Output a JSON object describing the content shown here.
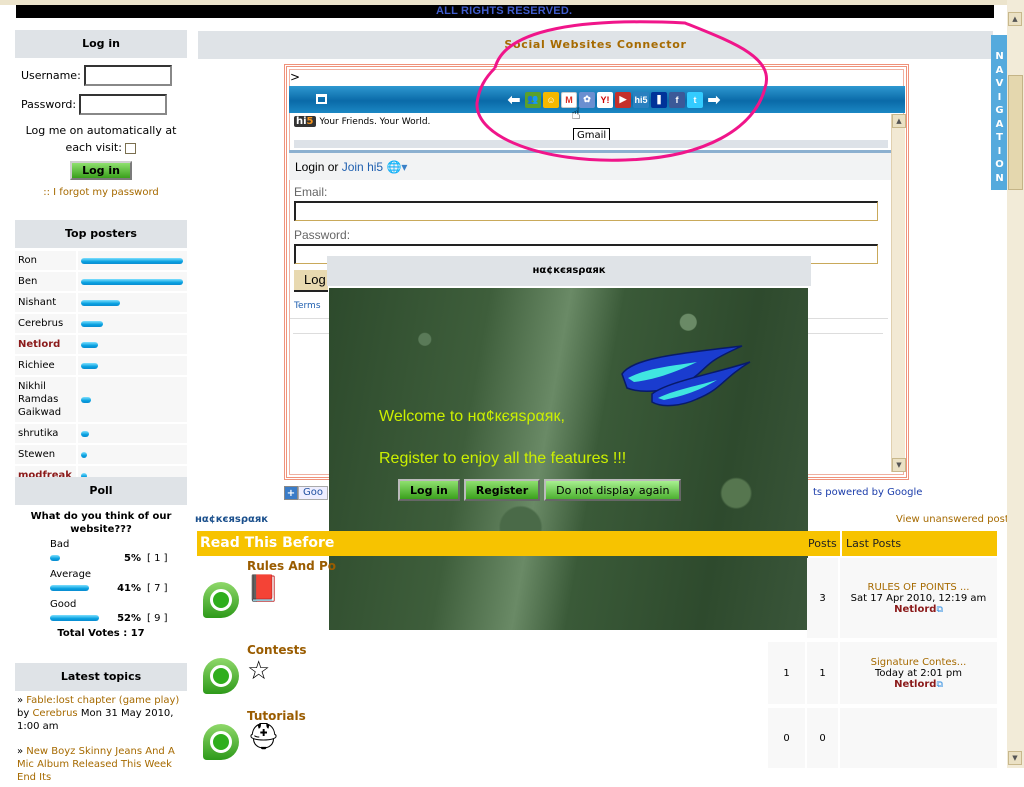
{
  "header": {
    "rights_text": "ALL RIGHTS RESERVED."
  },
  "login_box": {
    "title": "Log in",
    "username_label": "Username:",
    "username_value": "",
    "password_label": "Password:",
    "password_value": "",
    "auto_login_label_1": "Log me on automatically at",
    "auto_login_label_2": "each visit:",
    "auto_login_checked": false,
    "login_button": "Log in",
    "forgot_link": ":: I forgot my password"
  },
  "top_posters": {
    "title": "Top posters",
    "items": [
      {
        "name": "Ron",
        "moderator": false,
        "relative_posts": 1.0
      },
      {
        "name": "Ben",
        "moderator": false,
        "relative_posts": 1.0
      },
      {
        "name": "Nishant",
        "moderator": false,
        "relative_posts": 0.38
      },
      {
        "name": "Cerebrus",
        "moderator": false,
        "relative_posts": 0.22
      },
      {
        "name": "Netlord",
        "moderator": true,
        "relative_posts": 0.17
      },
      {
        "name": "Richiee",
        "moderator": false,
        "relative_posts": 0.17
      },
      {
        "name": "Nikhil Ramdas Gaikwad",
        "moderator": false,
        "relative_posts": 0.1
      },
      {
        "name": "shrutika",
        "moderator": false,
        "relative_posts": 0.08
      },
      {
        "name": "Stewen",
        "moderator": false,
        "relative_posts": 0.06
      },
      {
        "name": "modfreak",
        "moderator": true,
        "relative_posts": 0.06
      }
    ]
  },
  "poll": {
    "title": "Poll",
    "question": "What do you think of our website???",
    "options": [
      {
        "label": "Bad",
        "percent": "5%",
        "votes": "[ 1 ]",
        "fraction": 0.05
      },
      {
        "label": "Average",
        "percent": "41%",
        "votes": "[ 7 ]",
        "fraction": 0.41
      },
      {
        "label": "Good",
        "percent": "52%",
        "votes": "[ 9 ]",
        "fraction": 0.52
      }
    ],
    "total": "Total Votes : 17"
  },
  "latest_topics": {
    "title": "Latest topics",
    "items": [
      {
        "prefix": "» ",
        "title": "Fable:lost chapter (game play)",
        "by": "by ",
        "author": "Cerebrus",
        "date": " Mon 31 May 2010, 1:00 am"
      },
      {
        "prefix": "» ",
        "title": "New Boyz Skinny Jeans And A Mic Album Released This Week End Its",
        "by": "",
        "author": "",
        "date": ""
      }
    ]
  },
  "connector": {
    "title": "Social Websites Connector",
    "prompt": ">",
    "services": [
      {
        "name": "Windows Live Messenger",
        "glyph": "👥",
        "color": "#5aa02c"
      },
      {
        "name": "Yahoo Messenger",
        "glyph": "☺",
        "color": "#f5b800"
      },
      {
        "name": "Gmail",
        "glyph": "M",
        "color": "#d93025"
      },
      {
        "name": "MSN",
        "glyph": "✿",
        "color": "#6a8fd0"
      },
      {
        "name": "Yahoo",
        "glyph": "Y!",
        "color": "#7b0099"
      },
      {
        "name": "YouTube",
        "glyph": "▶",
        "color": "#c4302b"
      },
      {
        "name": "hi5",
        "glyph": "hi5",
        "color": "#2a80c0"
      },
      {
        "name": "MySpace",
        "glyph": "❚",
        "color": "#003399"
      },
      {
        "name": "Facebook",
        "glyph": "f",
        "color": "#3b5998"
      },
      {
        "name": "Twitter",
        "glyph": "t",
        "color": "#33ccff"
      }
    ],
    "tooltip": "Gmail",
    "hi5": {
      "logo_a": "hi",
      "logo_b": "5",
      "tagline": "Your Friends. Your World.",
      "login_text": "Login",
      "or_text": " or ",
      "join_link": "Join hi5",
      "email_label": "Email:",
      "email_value": "",
      "password_label": "Password:",
      "password_value": "",
      "login_button": "Log",
      "terms_link": "Terms"
    },
    "gplus_label": "Goo",
    "powered_text": "ts powered by Google"
  },
  "popup": {
    "title": "нα¢кєяѕραяк",
    "welcome": "Welcome to нα¢кєяѕραяк,",
    "message": "Register to enjoy all the features !!!",
    "login_button": "Log in",
    "register_button": "Register",
    "dismiss_button": "Do not display again"
  },
  "forum": {
    "site_name": "нα¢кєяѕραяк",
    "unanswered_link": "View unanswered posts",
    "category_title": "Read This Before",
    "col_posts": "Posts",
    "col_last": "Last Posts",
    "rows": [
      {
        "title": "Rules And Po",
        "icon": "rules-book-icon",
        "glyph": "📕",
        "topics": "",
        "posts": "3",
        "last_title": "RULES OF POINTS ...",
        "last_date": "Sat 17 Apr 2010, 12:19 am",
        "last_user": "Netlord"
      },
      {
        "title": "Contests",
        "icon": "star-icon",
        "glyph": "☆",
        "topics": "1",
        "posts": "1",
        "last_title": "Signature Contes...",
        "last_date": "Today at 2:01 pm",
        "last_user": "Netlord"
      },
      {
        "title": "Tutorials",
        "icon": "lifebuoy-icon",
        "glyph": "⛑",
        "topics": "0",
        "posts": "0",
        "last_title": "",
        "last_date": "",
        "last_user": ""
      }
    ]
  },
  "navigation_tab": {
    "label": "NAVIGATION"
  }
}
